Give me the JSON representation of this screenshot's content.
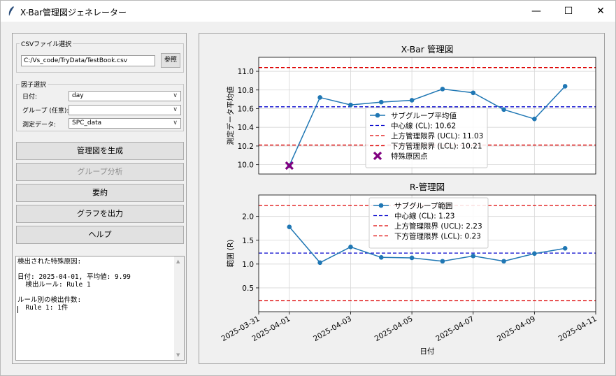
{
  "window": {
    "title": "X-Bar管理図ジェネレーター",
    "minimize": "—",
    "maximize": "☐",
    "close": "✕"
  },
  "csv": {
    "group_label": "CSVファイル選択",
    "path": "C:/Vs_code/TryData/TestBook.csv",
    "browse_label": "参照"
  },
  "factors": {
    "group_label": "因子選択",
    "date_label": "日付:",
    "date_value": "day",
    "group_field_label": "グループ (任意):",
    "group_value": "",
    "measure_label": "測定データ:",
    "measure_value": "SPC_data"
  },
  "buttons": {
    "generate": "管理図を生成",
    "group_analysis": "グループ分析",
    "summary": "要約",
    "export": "グラフを出力",
    "help": "ヘルプ"
  },
  "log": {
    "text": "検出された特殊原因:\n\n日付: 2025-04-01, 平均値: 9.99\n  検出ルール: Rule 1\n\nルール別の検出件数:\n  Rule 1: 1件"
  },
  "chart_data": [
    {
      "type": "line",
      "title": "X-Bar 管理図",
      "xlabel": "",
      "ylabel": "測定データ平均値",
      "x": [
        "2025-04-01",
        "2025-04-02",
        "2025-04-03",
        "2025-04-04",
        "2025-04-05",
        "2025-04-06",
        "2025-04-07",
        "2025-04-08",
        "2025-04-09",
        "2025-04-10"
      ],
      "series": [
        {
          "name": "サブグループ平均値",
          "values": [
            9.99,
            10.72,
            10.64,
            10.67,
            10.69,
            10.81,
            10.77,
            10.59,
            10.49,
            10.84
          ],
          "color": "#1f77b4"
        }
      ],
      "limits": [
        {
          "name": "中心線 (CL): 10.62",
          "value": 10.62,
          "color": "#0000cc"
        },
        {
          "name": "上方管理限界 (UCL): 11.03",
          "value": 11.04,
          "color": "#dd0000"
        },
        {
          "name": "下方管理限界 (LCL): 10.21",
          "value": 10.21,
          "color": "#dd0000"
        }
      ],
      "special_points": {
        "name": "特殊原因点",
        "x": [
          "2025-04-01"
        ],
        "values": [
          9.99
        ],
        "color": "#800080"
      },
      "ylim": [
        9.9,
        11.15
      ],
      "yticks": [
        "10.0",
        "10.2",
        "10.4",
        "10.6",
        "10.8",
        "11.0"
      ],
      "grid": true,
      "legend": "center"
    },
    {
      "type": "line",
      "title": "R-管理図",
      "xlabel": "日付",
      "ylabel": "範囲 (R)",
      "x": [
        "2025-04-01",
        "2025-04-02",
        "2025-04-03",
        "2025-04-04",
        "2025-04-05",
        "2025-04-06",
        "2025-04-07",
        "2025-04-08",
        "2025-04-09",
        "2025-04-10"
      ],
      "series": [
        {
          "name": "サブグループ範囲",
          "values": [
            1.78,
            1.03,
            1.36,
            1.14,
            1.13,
            1.06,
            1.17,
            1.06,
            1.22,
            1.33
          ],
          "color": "#1f77b4"
        }
      ],
      "limits": [
        {
          "name": "中心線 (CL): 1.23",
          "value": 1.23,
          "color": "#0000cc"
        },
        {
          "name": "上方管理限界 (UCL): 2.23",
          "value": 2.23,
          "color": "#dd0000"
        },
        {
          "name": "下方管理限界 (LCL): 0.23",
          "value": 0.23,
          "color": "#dd0000"
        }
      ],
      "ylim": [
        0.0,
        2.45
      ],
      "yticks": [
        "0.5",
        "1.0",
        "1.5",
        "2.0"
      ],
      "xticks": [
        "2025-03-31",
        "2025-04-01",
        "2025-04-03",
        "2025-04-05",
        "2025-04-07",
        "2025-04-09",
        "2025-04-11"
      ],
      "grid": true,
      "legend": "top-center"
    }
  ]
}
